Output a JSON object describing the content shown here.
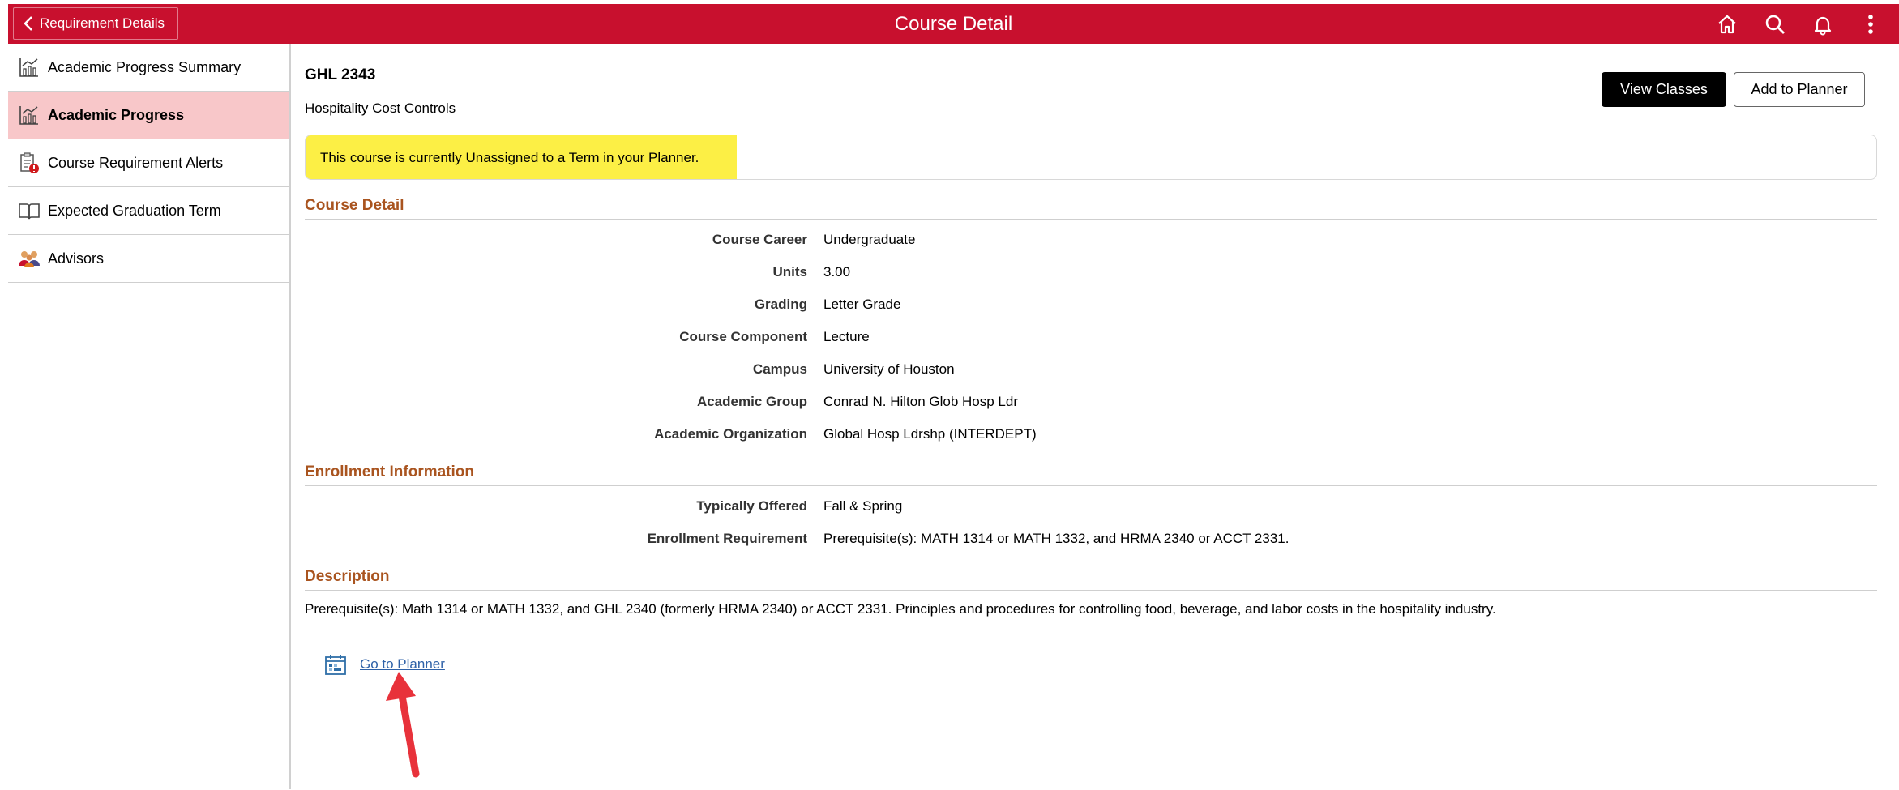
{
  "header": {
    "back_label": "Requirement Details",
    "title": "Course Detail",
    "icons": [
      "home-icon",
      "search-icon",
      "bell-icon",
      "more-icon"
    ],
    "background_color": "#c8102e"
  },
  "sidebar": {
    "items": [
      {
        "label": "Academic Progress Summary",
        "icon": "chart-icon",
        "active": false
      },
      {
        "label": "Academic Progress",
        "icon": "chart-icon",
        "active": true
      },
      {
        "label": "Course Requirement Alerts",
        "icon": "alert-clipboard-icon",
        "active": false
      },
      {
        "label": "Expected Graduation Term",
        "icon": "book-icon",
        "active": false
      },
      {
        "label": "Advisors",
        "icon": "people-icon",
        "active": false
      }
    ]
  },
  "course": {
    "code": "GHL 2343",
    "title": "Hospitality Cost Controls",
    "view_classes_label": "View Classes",
    "add_to_planner_label": "Add to Planner",
    "notice": "This course is currently Unassigned to a Term in your Planner."
  },
  "course_detail": {
    "heading": "Course Detail",
    "rows": [
      {
        "label": "Course Career",
        "value": "Undergraduate"
      },
      {
        "label": "Units",
        "value": "3.00"
      },
      {
        "label": "Grading",
        "value": "Letter Grade"
      },
      {
        "label": "Course Component",
        "value": "Lecture"
      },
      {
        "label": "Campus",
        "value": "University of Houston"
      },
      {
        "label": "Academic Group",
        "value": "Conrad N. Hilton Glob Hosp Ldr"
      },
      {
        "label": "Academic Organization",
        "value": "Global Hosp Ldrshp (INTERDEPT)"
      }
    ]
  },
  "enrollment": {
    "heading": "Enrollment Information",
    "rows": [
      {
        "label": "Typically Offered",
        "value": "Fall & Spring"
      },
      {
        "label": "Enrollment Requirement",
        "value": "Prerequisite(s): MATH 1314 or MATH 1332, and HRMA 2340 or ACCT 2331."
      }
    ]
  },
  "description": {
    "heading": "Description",
    "text": "Prerequisite(s): Math 1314 or MATH 1332, and GHL 2340 (formerly HRMA 2340) or ACCT 2331. Principles and procedures for controlling food, beverage, and labor costs in the hospitality industry.",
    "planner_link": "Go to Planner"
  },
  "colors": {
    "active_item": "#f8c7c9",
    "section_heading": "#a9541f",
    "notice_highlight": "#fcef45",
    "link": "#2f62a8",
    "annotation_arrow": "#e8323b"
  }
}
